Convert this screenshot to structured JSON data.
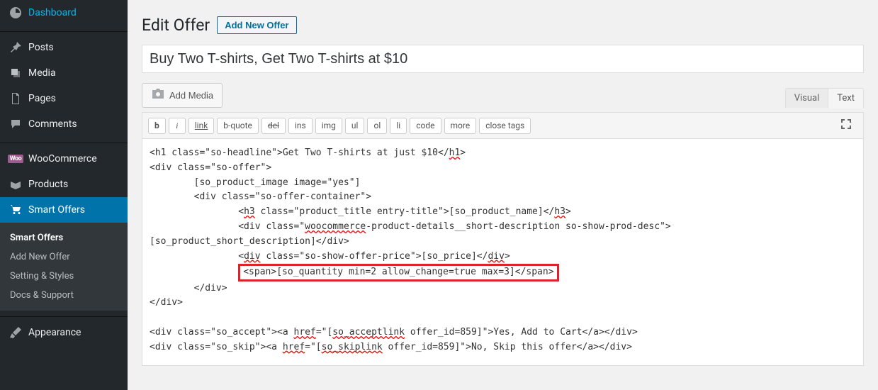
{
  "sidebar": {
    "items": [
      {
        "label": "Dashboard",
        "icon": "dashboard"
      },
      {
        "label": "Posts",
        "icon": "pin"
      },
      {
        "label": "Media",
        "icon": "media"
      },
      {
        "label": "Pages",
        "icon": "pages"
      },
      {
        "label": "Comments",
        "icon": "comments"
      },
      {
        "label": "WooCommerce",
        "icon": "woo"
      },
      {
        "label": "Products",
        "icon": "products"
      },
      {
        "label": "Smart Offers",
        "icon": "cart",
        "active": true
      },
      {
        "label": "Appearance",
        "icon": "brush"
      }
    ],
    "submenu": [
      {
        "label": "Smart Offers",
        "current": true
      },
      {
        "label": "Add New Offer"
      },
      {
        "label": "Setting & Styles"
      },
      {
        "label": "Docs & Support"
      }
    ]
  },
  "header": {
    "title": "Edit Offer",
    "add_new": "Add New Offer"
  },
  "title_field": {
    "value": "Buy Two T-shirts, Get Two T-shirts at $10"
  },
  "media_button": "Add Media",
  "tabs": {
    "visual": "Visual",
    "text": "Text"
  },
  "toolbar": {
    "b": "b",
    "i": "i",
    "link": "link",
    "bquote": "b-quote",
    "del": "del",
    "ins": "ins",
    "img": "img",
    "ul": "ul",
    "ol": "ol",
    "li": "li",
    "code": "code",
    "more": "more",
    "close": "close tags"
  },
  "editor": {
    "line1_a": "<h1 class=\"so-headline\">Get Two T-shirts at just $10</",
    "line1_b": "h1",
    "line1_c": ">",
    "line2": "<div class=\"so-offer\">",
    "line3": "        [so_product_image image=\"yes\"]",
    "line4": "        <div class=\"so-offer-container\">",
    "line5_a": "                <",
    "line5_b": "h3",
    "line5_c": " class=\"product_title entry-title\">[so_product_name]</",
    "line5_d": "h3",
    "line5_e": ">",
    "line6_a": "                <div class=\"",
    "line6_b": "woocommerce",
    "line6_c": "-product-details__short-description so-show-prod-desc\">",
    "line7": "[so_product_short_description]</div>",
    "line8_a": "                <",
    "line8_b": "div",
    "line8_c": " class=\"so-show-offer-price\">[so_price]</",
    "line8_d": "div",
    "line8_e": ">",
    "line9": "<span>[so_quantity min=2 allow_change=true max=3]</span>",
    "line10": "        </div>",
    "line11": "</div>",
    "line12_a": "<div class=\"so_accept\"><a ",
    "line12_b": "href",
    "line12_c": "=\"[",
    "line12_d": "so_acceptlink",
    "line12_e": " offer_id=859]\">Yes, Add to Cart</a></div>",
    "line13_a": "<div class=\"so_skip\"><a ",
    "line13_b": "href",
    "line13_c": "=\"[",
    "line13_d": "so_skiplink",
    "line13_e": " offer_id=859]\">No, Skip this offer</a></div>"
  }
}
